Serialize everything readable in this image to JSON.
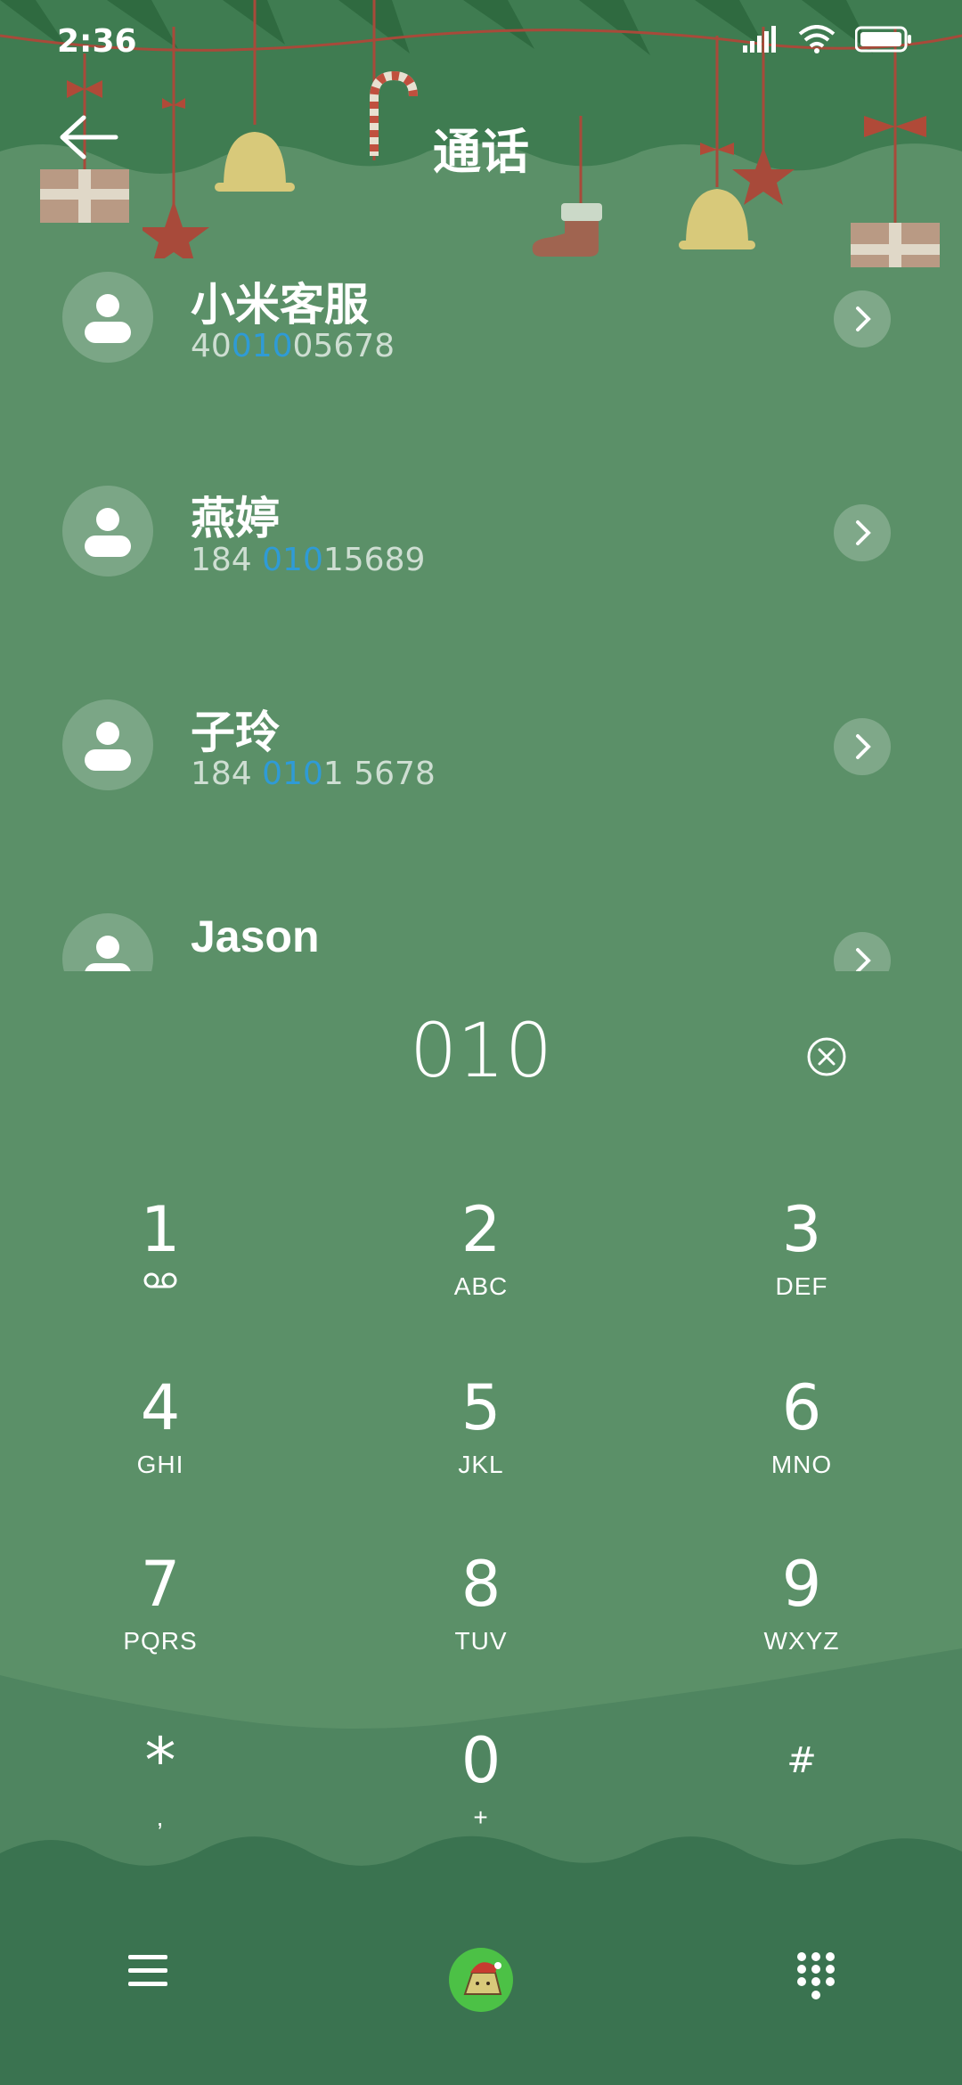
{
  "status_bar": {
    "time": "2:36"
  },
  "header": {
    "title": "通话"
  },
  "contacts": [
    {
      "name": "小米客服",
      "number_pre": "40",
      "number_match": "010",
      "number_post": "05678"
    },
    {
      "name": "燕婷",
      "number_pre": "184 ",
      "number_match": "010",
      "number_post": "15689"
    },
    {
      "name": "子玲",
      "number_pre": "184 ",
      "number_match": "010",
      "number_post": "1 5678"
    },
    {
      "name": "Jason",
      "number_pre": "",
      "number_match": "",
      "number_post": ""
    }
  ],
  "dial": {
    "value": "010"
  },
  "keypad": [
    {
      "digit": "1",
      "letters": ""
    },
    {
      "digit": "2",
      "letters": "ABC"
    },
    {
      "digit": "3",
      "letters": "DEF"
    },
    {
      "digit": "4",
      "letters": "GHI"
    },
    {
      "digit": "5",
      "letters": "JKL"
    },
    {
      "digit": "6",
      "letters": "MNO"
    },
    {
      "digit": "7",
      "letters": "PQRS"
    },
    {
      "digit": "8",
      "letters": "TUV"
    },
    {
      "digit": "9",
      "letters": "WXYZ"
    },
    {
      "digit": "*",
      "letters": ","
    },
    {
      "digit": "0",
      "letters": "+"
    },
    {
      "digit": "#",
      "letters": ""
    }
  ],
  "colors": {
    "background": "#5b9068",
    "header": "#3d7a4f",
    "highlight": "#2f9bd6",
    "ornament_red": "#a84a3a",
    "ornament_gold": "#d8c97a"
  }
}
